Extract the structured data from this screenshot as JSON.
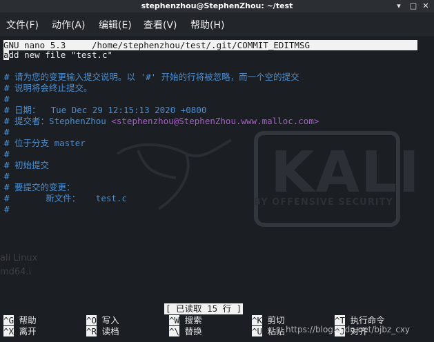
{
  "window": {
    "title": "stephenzhou@StephenZhou: ~/test",
    "controls": [
      "minimize-icon",
      "maximize-icon",
      "close-icon"
    ]
  },
  "menubar": {
    "items": [
      "文件(F)",
      "动作(A)",
      "编辑(E)",
      "查看(V)",
      "帮助(H)"
    ]
  },
  "nano": {
    "version": "GNU nano 5.3",
    "path": "/home/stephenzhou/test/.git/COMMIT_EDITMSG",
    "first_char": "a",
    "first_line_rest": "dd new file \"test.c\"",
    "comments": {
      "l1": "# 请为您的变更输入提交说明。以 '#' 开始的行将被忽略，而一个空的提交",
      "l2": "# 说明将会终止提交。",
      "l3": "#",
      "l4": "# 日期：  Tue Dec 29 12:15:13 2020 +0800",
      "l5_prefix": "# 提交者：StephenZhou ",
      "l5_email": "<stephenzhou@StephenZhou.www.malloc.com>",
      "l6": "#",
      "l7": "# 位于分支 master",
      "l8": "#",
      "l9": "# 初始提交",
      "l10": "#",
      "l11": "# 要提交的变更：",
      "l12": "#\t新文件：   test.c",
      "l13": "#"
    },
    "status": "[ 已读取 15 行 ]",
    "shortcuts": [
      {
        "key": "^G",
        "label": "帮助"
      },
      {
        "key": "^X",
        "label": "离开"
      },
      {
        "key": "^O",
        "label": "写入"
      },
      {
        "key": "^R",
        "label": "读档"
      },
      {
        "key": "^W",
        "label": "搜索"
      },
      {
        "key": "^\\",
        "label": "替换"
      },
      {
        "key": "^K",
        "label": "剪切"
      },
      {
        "key": "^U",
        "label": "粘贴"
      },
      {
        "key": "^T",
        "label": "执行命令"
      },
      {
        "key": "^J",
        "label": "对齐"
      }
    ]
  },
  "background": {
    "logo_text": "KALI",
    "logo_sub": "BY OFFENSIVE SECURITY",
    "desktop_labels": [
      "ali Linux",
      "md64.i"
    ]
  },
  "watermark": "https://blog.csdn.net/bjbz_cxy"
}
